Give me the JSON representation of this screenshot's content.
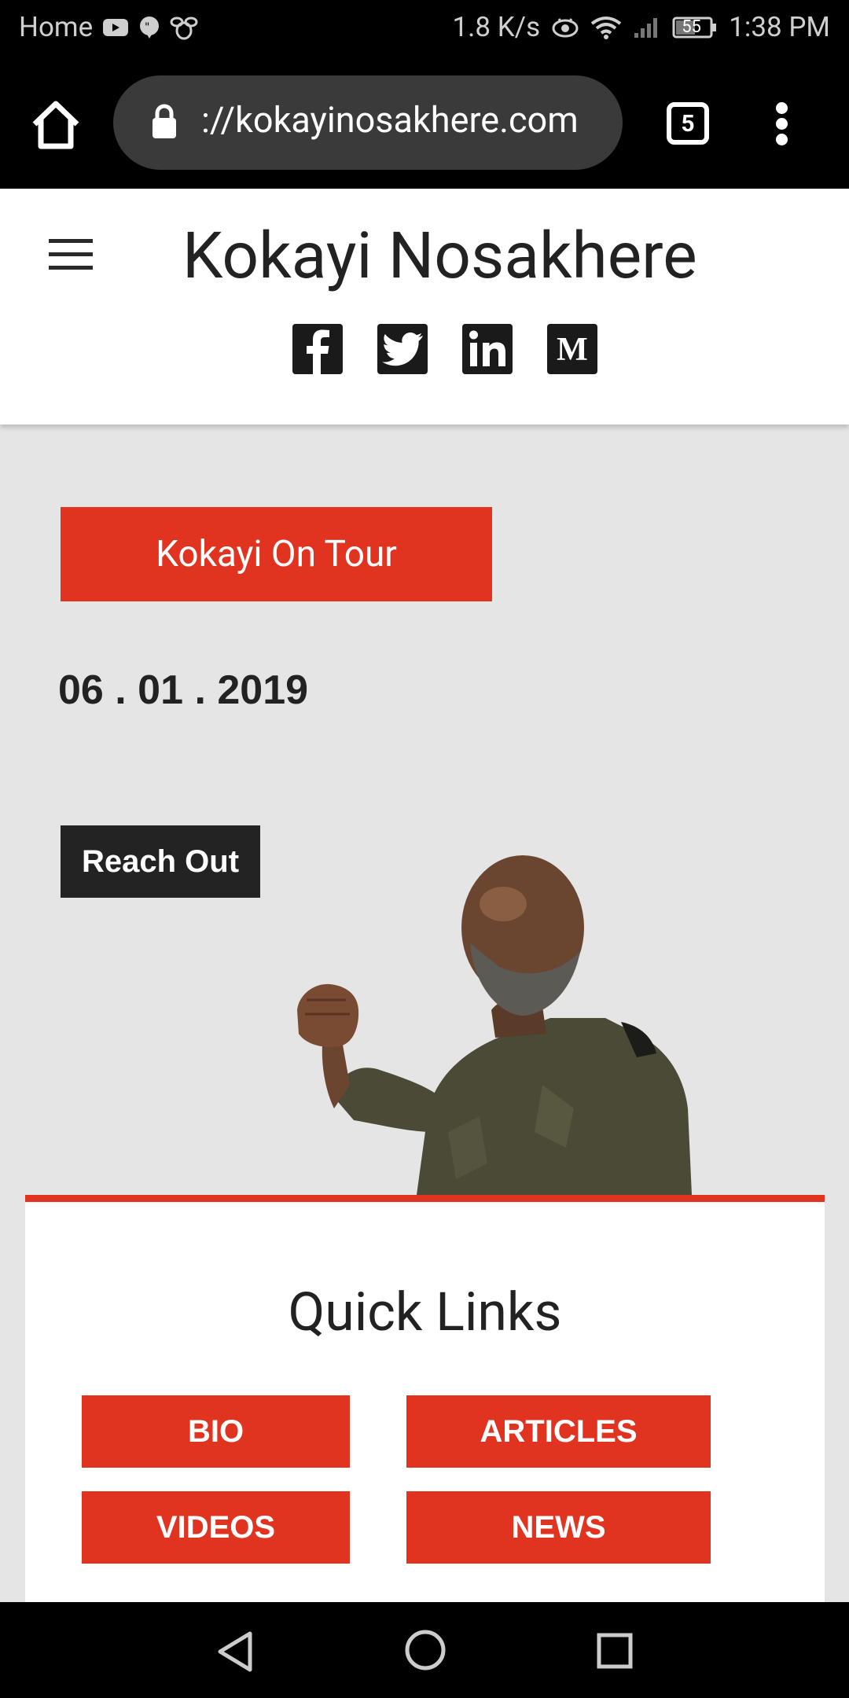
{
  "status_bar": {
    "left_label": "Home",
    "net_speed": "1.8 K/s",
    "battery": "55",
    "time": "1:38 PM"
  },
  "browser": {
    "url": "://kokayinosakhere.com",
    "tab_count": "5"
  },
  "site": {
    "title": "Kokayi Nosakhere",
    "social_icons": [
      "facebook-icon",
      "twitter-icon",
      "linkedin-icon",
      "medium-icon"
    ]
  },
  "content": {
    "tour_button": "Kokayi On Tour",
    "date": "06 . 01 . 2019",
    "reach_out_button": "Reach Out"
  },
  "quick_links": {
    "title": "Quick Links",
    "buttons": [
      "BIO",
      "ARTICLES",
      "VIDEOS",
      "NEWS"
    ]
  },
  "colors": {
    "accent": "#e03421",
    "dark": "#232323",
    "background": "#e6e5e6"
  }
}
